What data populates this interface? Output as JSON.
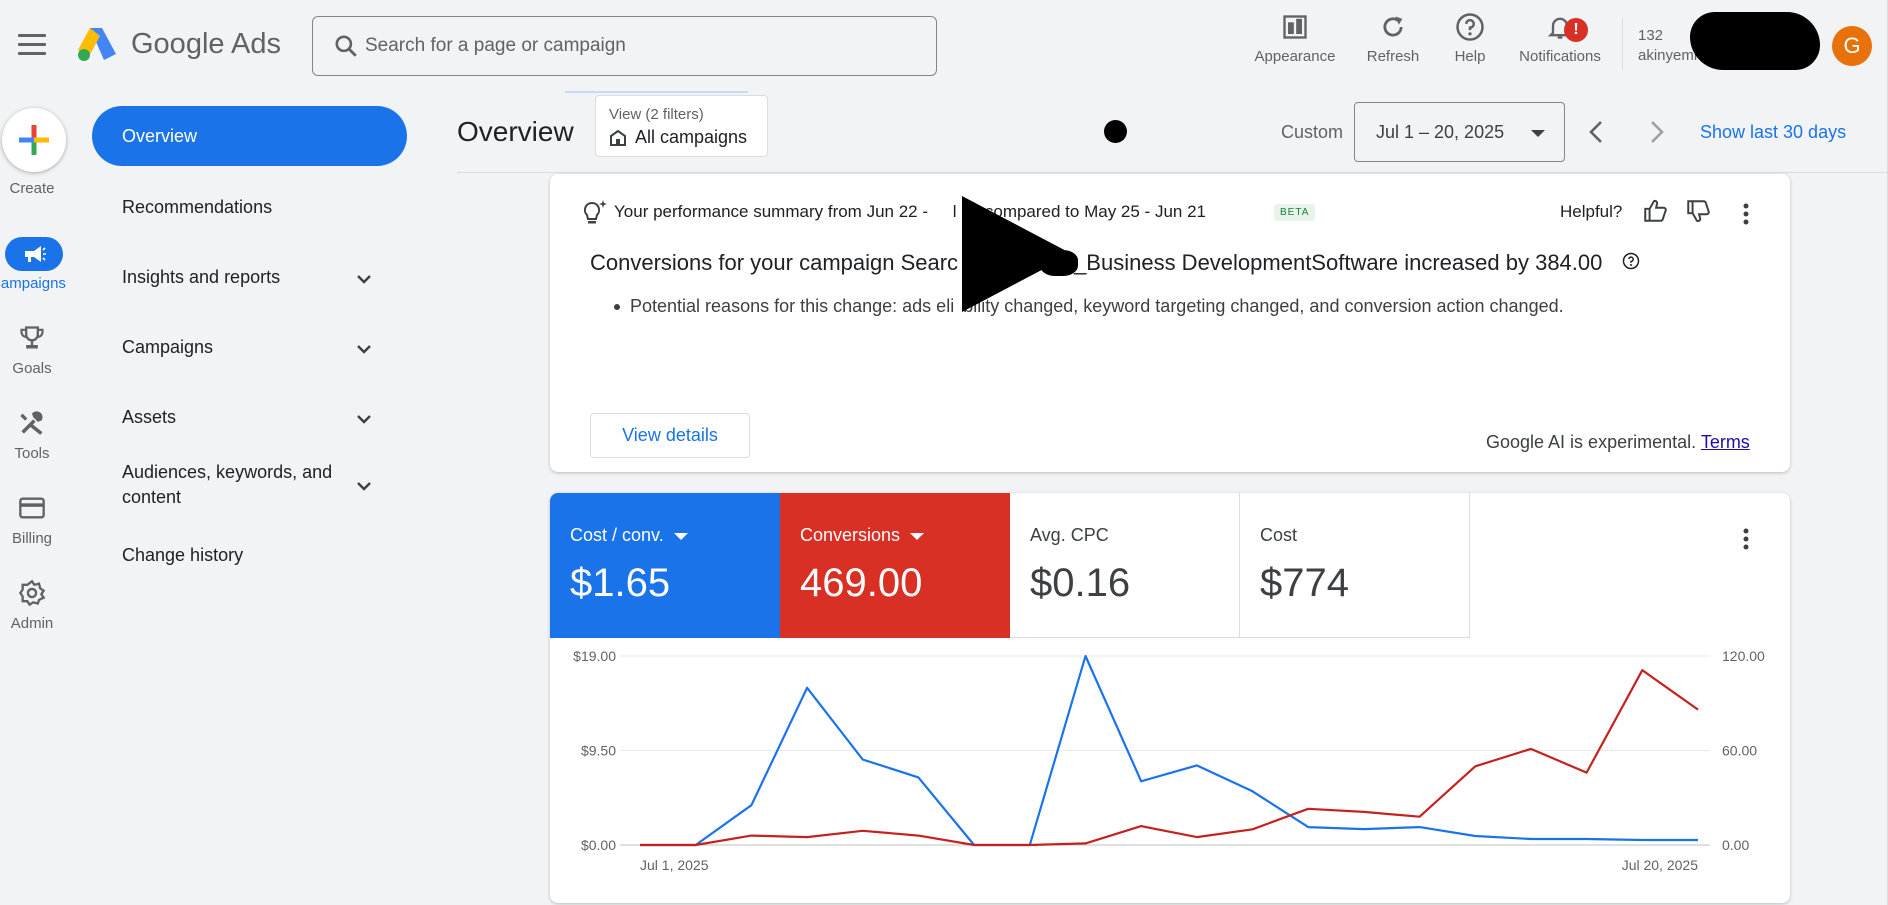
{
  "header": {
    "brand_google": "Google",
    "brand_ads": "Ads",
    "search_placeholder": "Search for a page or campaign",
    "actions": [
      {
        "label": "Appearance",
        "icon": "appearance-icon"
      },
      {
        "label": "Refresh",
        "icon": "refresh-icon"
      },
      {
        "label": "Help",
        "icon": "help-icon"
      },
      {
        "label": "Notifications",
        "icon": "bell-icon",
        "badge": "!"
      }
    ],
    "account_id": "132",
    "account_email": "akinyemi",
    "avatar_letter": "G"
  },
  "rail": {
    "create": "Create",
    "items": [
      "Campaigns",
      "Goals",
      "Tools",
      "Billing",
      "Admin"
    ]
  },
  "nav": {
    "items": [
      "Overview",
      "Recommendations",
      "Insights and reports",
      "Campaigns",
      "Assets",
      "Audiences, keywords, and",
      "content",
      "Change history"
    ]
  },
  "toolbar": {
    "title": "Overview",
    "filter_label": "View (2 filters)",
    "filter_value": "All campaigns",
    "custom_label": "Custom",
    "date_range": "Jul 1 – 20, 2025",
    "show_last": "Show last 30 days"
  },
  "summary": {
    "heading": "Your performance summary from Jun 22 -",
    "heading_mid": "l 19 compared to May 25 - Jun 21",
    "beta": "BETA",
    "helpful": "Helpful?",
    "title_a": "Conversions for your campaign Searc",
    "title_b": "_Business DevelopmentSoftware increased by 384.00",
    "bullet_a": "Potential reasons for this change: ads eli",
    "bullet_b": "bility changed, keyword targeting changed, and conversion action changed.",
    "view_details": "View details",
    "ai_note": "Google AI is experimental.",
    "terms": "Terms"
  },
  "metrics": [
    {
      "name": "Cost / conv.",
      "value": "$1.65",
      "color": "#1a73e8",
      "dropdown": true
    },
    {
      "name": "Conversions",
      "value": "469.00",
      "color": "#d93025",
      "dropdown": true
    },
    {
      "name": "Avg. CPC",
      "value": "$0.16"
    },
    {
      "name": "Cost",
      "value": "$774"
    }
  ],
  "chart_data": {
    "type": "line",
    "x": [
      "Jul 1, 2025",
      "Jul 2",
      "Jul 3",
      "Jul 4",
      "Jul 5",
      "Jul 6",
      "Jul 7",
      "Jul 8",
      "Jul 9",
      "Jul 10",
      "Jul 11",
      "Jul 12",
      "Jul 13",
      "Jul 14",
      "Jul 15",
      "Jul 16",
      "Jul 17",
      "Jul 18",
      "Jul 19",
      "Jul 20, 2025"
    ],
    "x_tick_labels": [
      "Jul 1, 2025",
      "Jul 20, 2025"
    ],
    "y_left": {
      "ticks": [
        "$0.00",
        "$9.50",
        "$19.00"
      ],
      "lim": [
        0,
        19
      ]
    },
    "y_right": {
      "ticks": [
        "0.00",
        "60.00",
        "120.00"
      ],
      "lim": [
        0,
        120
      ]
    },
    "series": [
      {
        "name": "Cost / conv.",
        "axis": "left",
        "color": "#1a73e8",
        "values": [
          0,
          0,
          4.0,
          15.8,
          8.6,
          6.8,
          0,
          0,
          19.0,
          6.4,
          8.0,
          5.4,
          1.8,
          1.6,
          1.8,
          0.9,
          0.6,
          0.6,
          0.5,
          0.5
        ]
      },
      {
        "name": "Conversions",
        "axis": "right",
        "color": "#c5221f",
        "values": [
          0,
          0,
          6,
          5,
          9,
          6,
          0,
          0,
          1,
          12,
          5,
          10,
          23,
          21,
          18,
          50,
          61,
          46,
          111,
          86
        ]
      }
    ],
    "grid": true
  }
}
